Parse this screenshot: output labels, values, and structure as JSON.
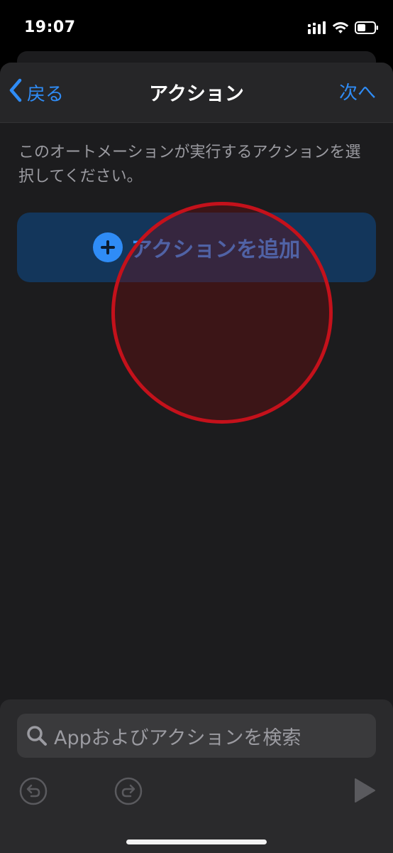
{
  "status_bar": {
    "time": "19:07",
    "icons": [
      "cellular-signal-icon",
      "wifi-icon",
      "battery-icon"
    ]
  },
  "nav": {
    "back_label": "戻る",
    "title": "アクション",
    "next_label": "次へ"
  },
  "content": {
    "instruction": "このオートメーションが実行するアクションを選択してください。",
    "add_action_label": "アクションを追加"
  },
  "search": {
    "placeholder": "Appおよびアクションを検索"
  },
  "toolbar": {
    "icons": [
      "undo-icon",
      "redo-icon",
      "play-icon"
    ]
  },
  "colors": {
    "accent": "#2f8cf6",
    "sheet_bg": "#1c1c1e",
    "nav_bg": "#262628",
    "add_button_bg": "#13365b",
    "highlight_ring": "#c4111b",
    "secondary_text": "#9b9ba1"
  }
}
